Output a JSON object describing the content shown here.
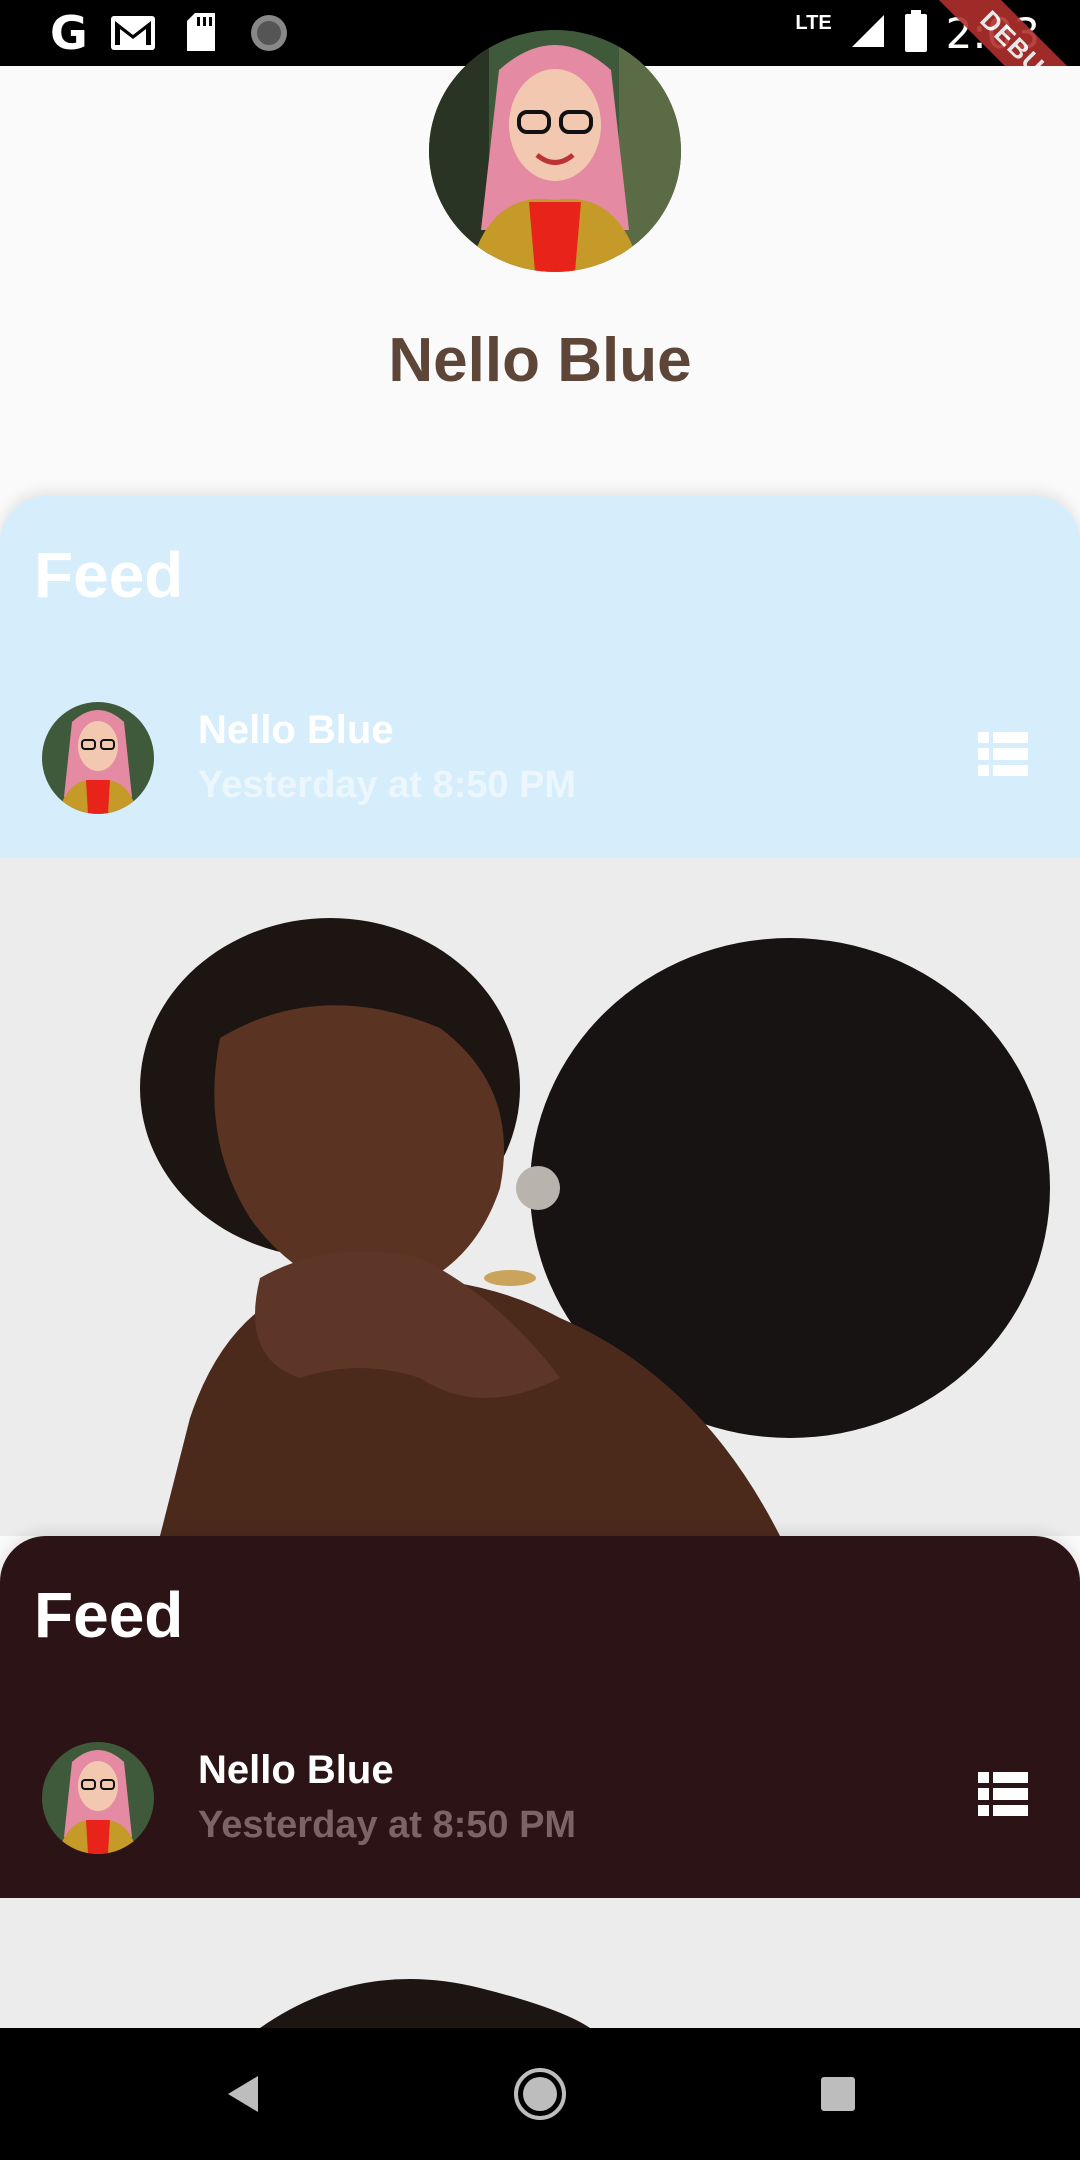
{
  "status_bar": {
    "carrier_icon": "google-g-icon",
    "icons": [
      "gmail-icon",
      "sd-card-icon",
      "sync-circle-icon"
    ],
    "network": "LTE",
    "time": "2:03",
    "debug_banner": "DEBUG"
  },
  "profile": {
    "name": "Nello Blue",
    "avatar": "profile-photo"
  },
  "feeds": [
    {
      "title": "Feed",
      "author": "Nello Blue",
      "timestamp": "Yesterday at 8:50 PM",
      "menu_icon": "list-icon",
      "accent": "#d6edfb"
    },
    {
      "title": "Feed",
      "author": "Nello Blue",
      "timestamp": "Yesterday at 8:50 PM",
      "menu_icon": "list-icon",
      "accent": "#2c1316"
    }
  ],
  "nav": {
    "icons": [
      "back-icon",
      "home-icon",
      "recents-icon"
    ]
  }
}
